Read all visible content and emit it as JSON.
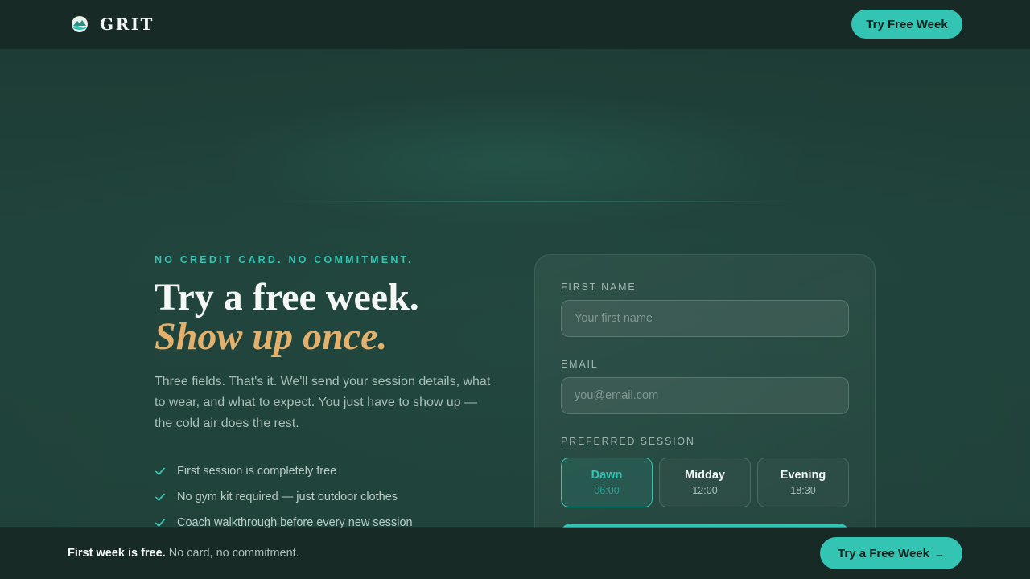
{
  "header": {
    "brand_name": "GRIT",
    "brand_icon": "wave-mountain-icon",
    "cta_label": "Try Free Week"
  },
  "hero": {
    "eyebrow": "NO CREDIT CARD. NO COMMITMENT.",
    "headline": "Try a free week.",
    "headline_accent": "Show up once.",
    "description": "Three fields. That's it. We'll send your session details, what to wear, and what to expect. You just have to show up — the cold air does the rest.",
    "benefits": [
      "First session is completely free",
      "No gym kit required — just outdoor clothes",
      "Coach walkthrough before every new session"
    ]
  },
  "form": {
    "first_name": {
      "label": "FIRST NAME",
      "placeholder": "Your first name",
      "value": ""
    },
    "email": {
      "label": "EMAIL",
      "placeholder": "you@email.com",
      "value": ""
    },
    "session": {
      "label": "PREFERRED SESSION",
      "selected": "Dawn",
      "options": [
        {
          "name": "Dawn",
          "time": "06:00"
        },
        {
          "name": "Midday",
          "time": "12:00"
        },
        {
          "name": "Evening",
          "time": "18:30"
        }
      ]
    }
  },
  "bottom_bar": {
    "bold_text": "First week is free.",
    "text": "No card, no commitment.",
    "cta_label": "Try a Free Week",
    "cta_icon": "arrow-right-icon"
  },
  "colors": {
    "accent": "#33c4b3",
    "gold": "#e3b16b",
    "background": "#1d3d36",
    "bar": "#172a26"
  }
}
